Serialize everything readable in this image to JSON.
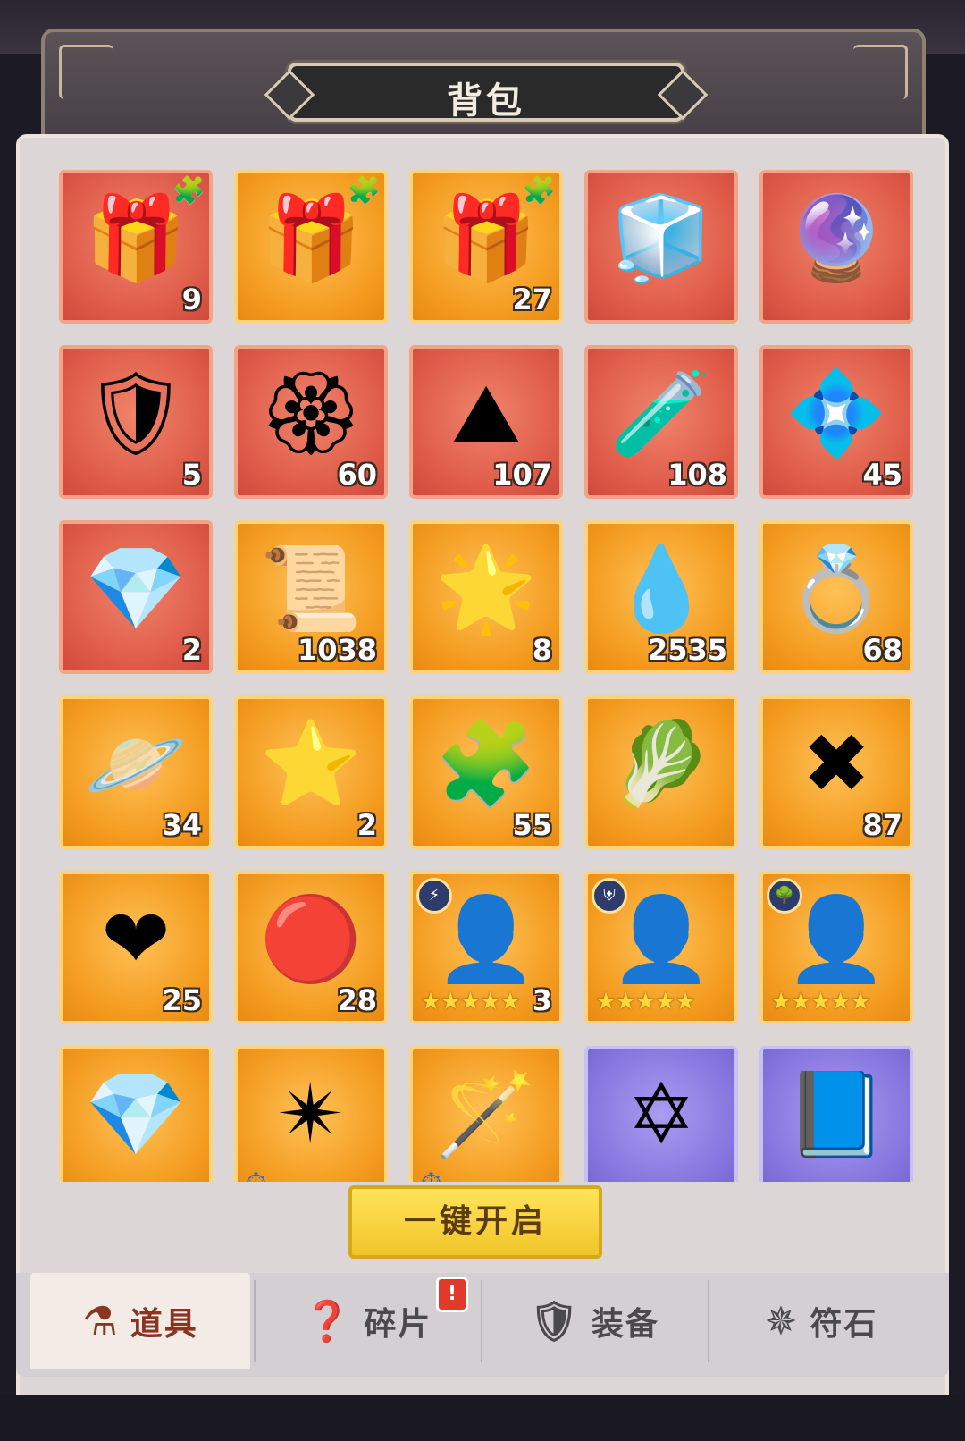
{
  "title": "背包",
  "open_all_button": "一键开启",
  "items": [
    {
      "rarity": "red",
      "icon": "🎁",
      "qty": "9",
      "puzzle": true
    },
    {
      "rarity": "gold",
      "icon": "🎁",
      "qty": "",
      "puzzle": true
    },
    {
      "rarity": "gold",
      "icon": "🎁",
      "qty": "27",
      "puzzle": true
    },
    {
      "rarity": "red",
      "icon": "🧊",
      "qty": ""
    },
    {
      "rarity": "red",
      "icon": "🔮",
      "qty": ""
    },
    {
      "rarity": "red",
      "icon": "🛡",
      "qty": "5"
    },
    {
      "rarity": "red",
      "icon": "🏵",
      "qty": "60"
    },
    {
      "rarity": "red",
      "icon": "⛰",
      "qty": "107"
    },
    {
      "rarity": "red",
      "icon": "🧪",
      "qty": "108"
    },
    {
      "rarity": "red",
      "icon": "💠",
      "qty": "45"
    },
    {
      "rarity": "red",
      "icon": "💎",
      "qty": "2"
    },
    {
      "rarity": "gold",
      "icon": "📜",
      "qty": "1038"
    },
    {
      "rarity": "gold",
      "icon": "🌟",
      "qty": "8"
    },
    {
      "rarity": "gold",
      "icon": "💧",
      "qty": "2535"
    },
    {
      "rarity": "gold",
      "icon": "💍",
      "qty": "68"
    },
    {
      "rarity": "gold",
      "icon": "🪐",
      "qty": "34"
    },
    {
      "rarity": "gold",
      "icon": "⭐",
      "qty": "2"
    },
    {
      "rarity": "gold",
      "icon": "🧩",
      "qty": "55"
    },
    {
      "rarity": "gold",
      "icon": "🥬",
      "qty": ""
    },
    {
      "rarity": "gold",
      "icon": "✖",
      "qty": "87"
    },
    {
      "rarity": "gold",
      "icon": "❤",
      "qty": "25"
    },
    {
      "rarity": "gold",
      "icon": "🔴",
      "qty": "28"
    },
    {
      "rarity": "gold",
      "icon": "👤",
      "qty": "3",
      "stars": "★★★★★",
      "faction": "⚡"
    },
    {
      "rarity": "gold",
      "icon": "👤",
      "qty": "",
      "stars": "★★★★★",
      "faction": "⛨"
    },
    {
      "rarity": "gold",
      "icon": "👤",
      "qty": "",
      "stars": "★★★★★",
      "faction": "🌳"
    },
    {
      "rarity": "gold",
      "icon": "💎",
      "qty": ""
    },
    {
      "rarity": "gold",
      "icon": "✴",
      "qty": "",
      "timer": true
    },
    {
      "rarity": "gold",
      "icon": "🪄",
      "qty": "",
      "timer": true
    },
    {
      "rarity": "purple",
      "icon": "✡",
      "qty": ""
    },
    {
      "rarity": "purple",
      "icon": "📘",
      "qty": ""
    }
  ],
  "tabs": [
    {
      "label": "道具",
      "icon": "⚗",
      "active": true
    },
    {
      "label": "碎片",
      "icon": "❓",
      "alert": "!"
    },
    {
      "label": "装备",
      "icon": "🛡"
    },
    {
      "label": "符石",
      "icon": "✵"
    }
  ],
  "colors": {
    "accent": "#f1c52a",
    "active_tab_text": "#8a3422",
    "alert": "#e23a2a"
  }
}
